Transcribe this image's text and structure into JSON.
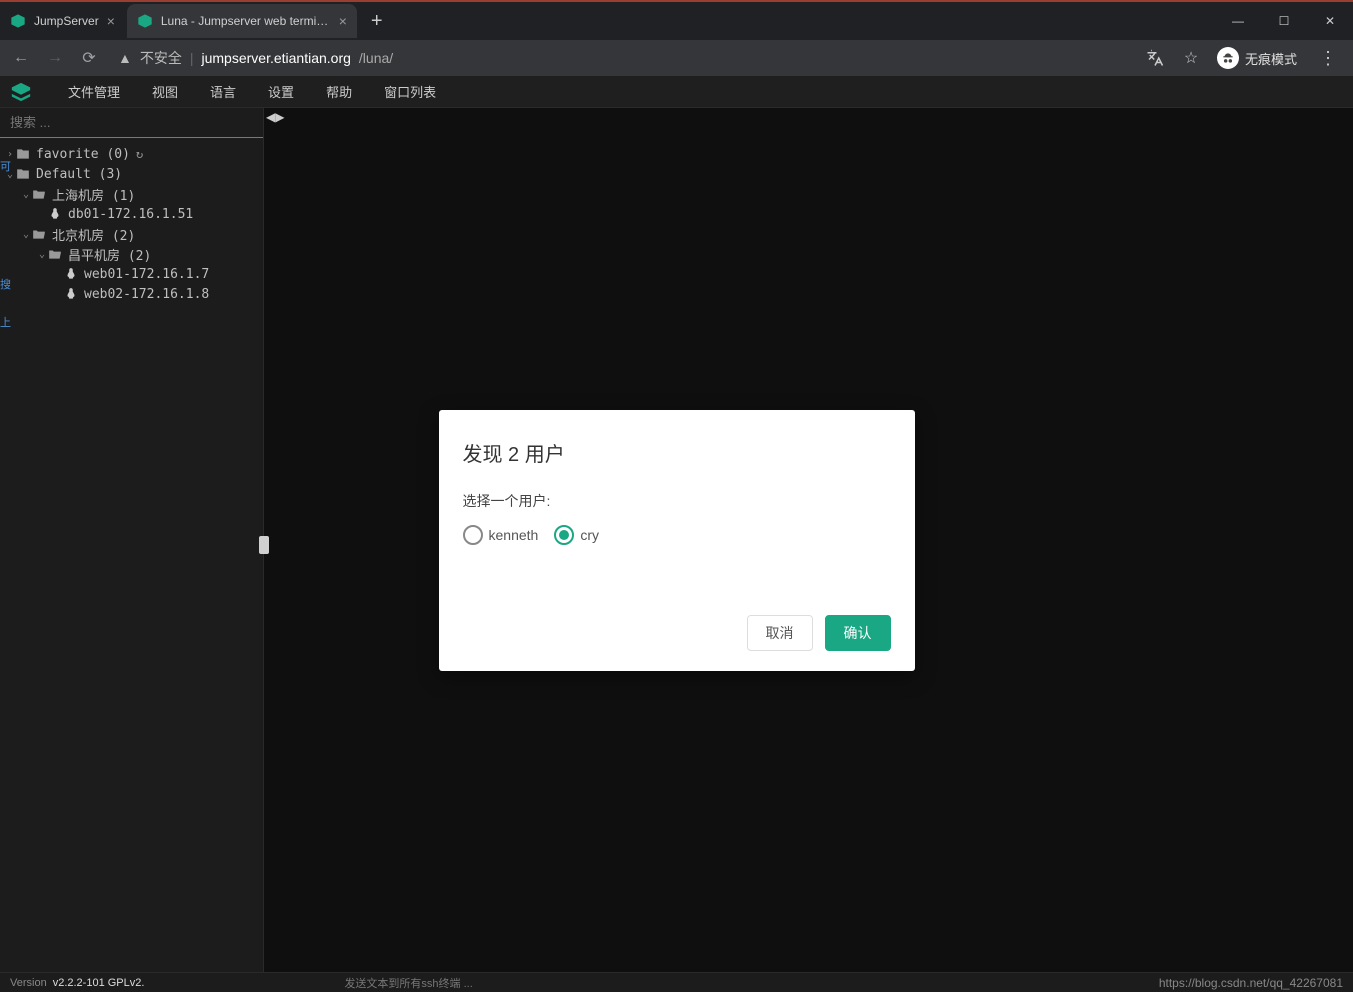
{
  "browser": {
    "tabs": [
      {
        "title": "JumpServer",
        "active": false
      },
      {
        "title": "Luna - Jumpserver web termin…",
        "active": true
      }
    ],
    "addr": {
      "security_label": "不安全",
      "host": "jumpserver.etiantian.org",
      "path": "/luna/"
    },
    "incognito_label": "无痕模式"
  },
  "menubar": {
    "items": [
      "文件管理",
      "视图",
      "语言",
      "设置",
      "帮助",
      "窗口列表"
    ]
  },
  "sidebar": {
    "search_placeholder": "搜索 ...",
    "tree": [
      {
        "indent": 0,
        "caret": "›",
        "icon": "folder",
        "label": "favorite (0)",
        "refresh": true
      },
      {
        "indent": 0,
        "caret": "⌄",
        "icon": "folder",
        "label": "Default (3)"
      },
      {
        "indent": 1,
        "caret": "⌄",
        "icon": "folder-open",
        "label": "上海机房 (1)"
      },
      {
        "indent": 2,
        "caret": "",
        "icon": "linux",
        "label": "db01-172.16.1.51"
      },
      {
        "indent": 1,
        "caret": "⌄",
        "icon": "folder-open",
        "label": "北京机房 (2)"
      },
      {
        "indent": 2,
        "caret": "⌄",
        "icon": "folder-open",
        "label": "昌平机房 (2)"
      },
      {
        "indent": 3,
        "caret": "",
        "icon": "linux",
        "label": "web01-172.16.1.7"
      },
      {
        "indent": 3,
        "caret": "",
        "icon": "linux",
        "label": "web02-172.16.1.8"
      }
    ]
  },
  "dialog": {
    "title": "发现 2 用户",
    "prompt": "选择一个用户:",
    "options": [
      {
        "label": "kenneth",
        "selected": false
      },
      {
        "label": "cry",
        "selected": true
      }
    ],
    "cancel": "取消",
    "confirm": "确认"
  },
  "status": {
    "version_prefix": "Version ",
    "version": "v2.2.2-101 GPLv2.",
    "send_hint": "发送文本到所有ssh终端 ...",
    "watermark": "https://blog.csdn.net/qq_42267081"
  },
  "left_gutter": {
    "a": "可",
    "b": "搜",
    "c": "上"
  }
}
